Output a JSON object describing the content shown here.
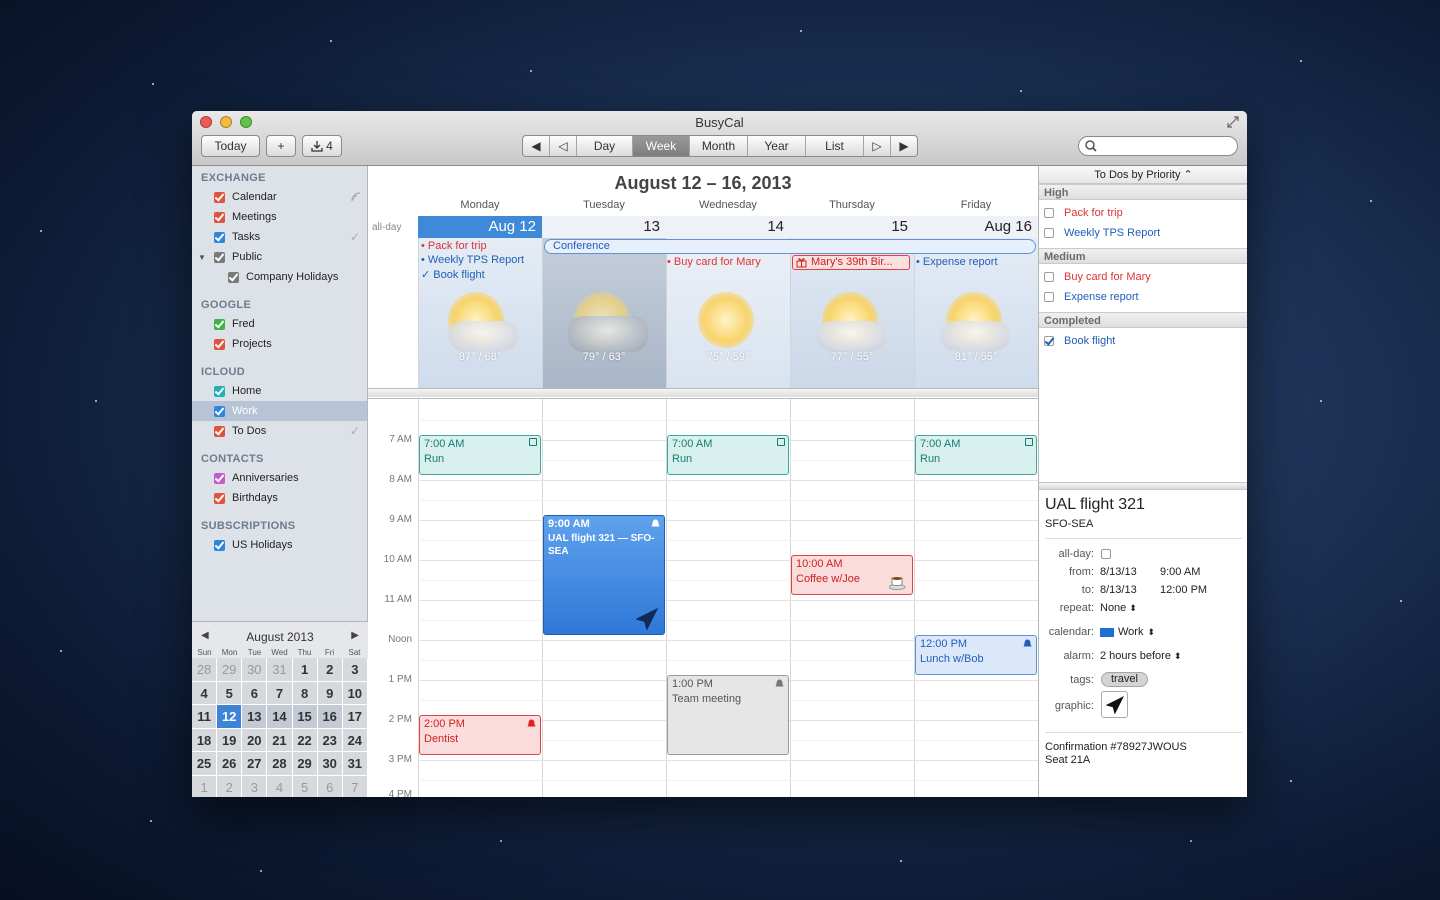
{
  "window": {
    "title": "BusyCal"
  },
  "toolbar": {
    "today_label": "Today",
    "add_label": "+",
    "download_count": "4",
    "views": [
      "Day",
      "Week",
      "Month",
      "Year",
      "List"
    ],
    "active_view": "Week",
    "search_placeholder": ""
  },
  "sidebar": {
    "sections": [
      {
        "title": "EXCHANGE",
        "calendars": [
          {
            "name": "Calendar",
            "color": "#e0533d"
          },
          {
            "name": "Meetings",
            "color": "#e0533d"
          },
          {
            "name": "Tasks",
            "color": "#2d86d9"
          },
          {
            "name": "Public",
            "color": "#7a7a7a"
          },
          {
            "name": "Company Holidays",
            "color": "#7a7a7a"
          }
        ]
      },
      {
        "title": "GOOGLE",
        "calendars": [
          {
            "name": "Fred",
            "color": "#3db34a"
          },
          {
            "name": "Projects",
            "color": "#e0533d"
          }
        ]
      },
      {
        "title": "ICLOUD",
        "calendars": [
          {
            "name": "Home",
            "color": "#1fb0b8"
          },
          {
            "name": "Work",
            "color": "#2d86d9"
          },
          {
            "name": "To Dos",
            "color": "#e0533d"
          }
        ]
      },
      {
        "title": "CONTACTS",
        "calendars": [
          {
            "name": "Anniversaries",
            "color": "#c25cc9"
          },
          {
            "name": "Birthdays",
            "color": "#e0533d"
          }
        ]
      },
      {
        "title": "SUBSCRIPTIONS",
        "calendars": [
          {
            "name": "US Holidays",
            "color": "#2d86d9"
          }
        ]
      }
    ],
    "selected": "Work"
  },
  "minical": {
    "month": "August 2013",
    "dow": [
      "Sun",
      "Mon",
      "Tue",
      "Wed",
      "Thu",
      "Fri",
      "Sat"
    ],
    "weeks": [
      [
        "28",
        "29",
        "30",
        "31",
        "1",
        "2",
        "3"
      ],
      [
        "4",
        "5",
        "6",
        "7",
        "8",
        "9",
        "10"
      ],
      [
        "11",
        "12",
        "13",
        "14",
        "15",
        "16",
        "17"
      ],
      [
        "18",
        "19",
        "20",
        "21",
        "22",
        "23",
        "24"
      ],
      [
        "25",
        "26",
        "27",
        "28",
        "29",
        "30",
        "31"
      ],
      [
        "1",
        "2",
        "3",
        "4",
        "5",
        "6",
        "7"
      ]
    ],
    "today": "12"
  },
  "week": {
    "title": "August 12 – 16, 2013",
    "allday_label": "all-day",
    "days": [
      {
        "name": "Monday",
        "num": "Aug 12",
        "weather": "87° / 68°"
      },
      {
        "name": "Tuesday",
        "num": "13",
        "weather": "79° / 63°"
      },
      {
        "name": "Wednesday",
        "num": "14",
        "weather": "75° / 59°"
      },
      {
        "name": "Thursday",
        "num": "15",
        "weather": "77° / 55°"
      },
      {
        "name": "Friday",
        "num": "Aug 16",
        "weather": "81° / 55°"
      }
    ],
    "allday_events": {
      "pack": "• Pack for trip",
      "tps": "• Weekly TPS Report",
      "book": "✓ Book flight",
      "conference": "Conference",
      "buycard": "• Buy card for Mary",
      "birthday": "Mary's 39th Bir...",
      "expense": "• Expense report"
    },
    "hours": [
      "7 AM",
      "8 AM",
      "9 AM",
      "10 AM",
      "11 AM",
      "Noon",
      "1 PM",
      "2 PM",
      "3 PM",
      "4 PM"
    ],
    "events": {
      "run1": {
        "time": "7:00 AM",
        "title": "Run"
      },
      "run2": {
        "time": "7:00 AM",
        "title": "Run"
      },
      "run3": {
        "time": "7:00 AM",
        "title": "Run"
      },
      "flight": {
        "time": "9:00 AM",
        "title": "UAL flight 321 — SFO-SEA"
      },
      "coffee": {
        "time": "10:00 AM",
        "title": "Coffee w/Joe"
      },
      "lunch": {
        "time": "12:00 PM",
        "title": "Lunch w/Bob"
      },
      "meeting": {
        "time": "1:00 PM",
        "title": "Team meeting"
      },
      "dentist": {
        "time": "2:00 PM",
        "title": "Dentist"
      }
    }
  },
  "todos": {
    "header": "To Dos by Priority ⌃",
    "groups": {
      "high": "High",
      "medium": "Medium",
      "completed": "Completed"
    },
    "items": {
      "pack": "Pack for trip",
      "tps": "Weekly TPS Report",
      "buycard": "Buy card for Mary",
      "expense": "Expense report",
      "book": "Book flight"
    }
  },
  "inspector": {
    "title": "UAL flight 321",
    "subtitle": "SFO-SEA",
    "allday_label": "all-day:",
    "from_label": "from:",
    "from_date": "8/13/13",
    "from_time": "9:00 AM",
    "to_label": "to:",
    "to_date": "8/13/13",
    "to_time": "12:00 PM",
    "repeat_label": "repeat:",
    "repeat_value": "None",
    "calendar_label": "calendar:",
    "calendar_value": "Work",
    "alarm_label": "alarm:",
    "alarm_value": "2 hours before",
    "tags_label": "tags:",
    "tag": "travel",
    "graphic_label": "graphic:",
    "notes_line1": "Confirmation #78927JWOUS",
    "notes_line2": "Seat 21A"
  }
}
